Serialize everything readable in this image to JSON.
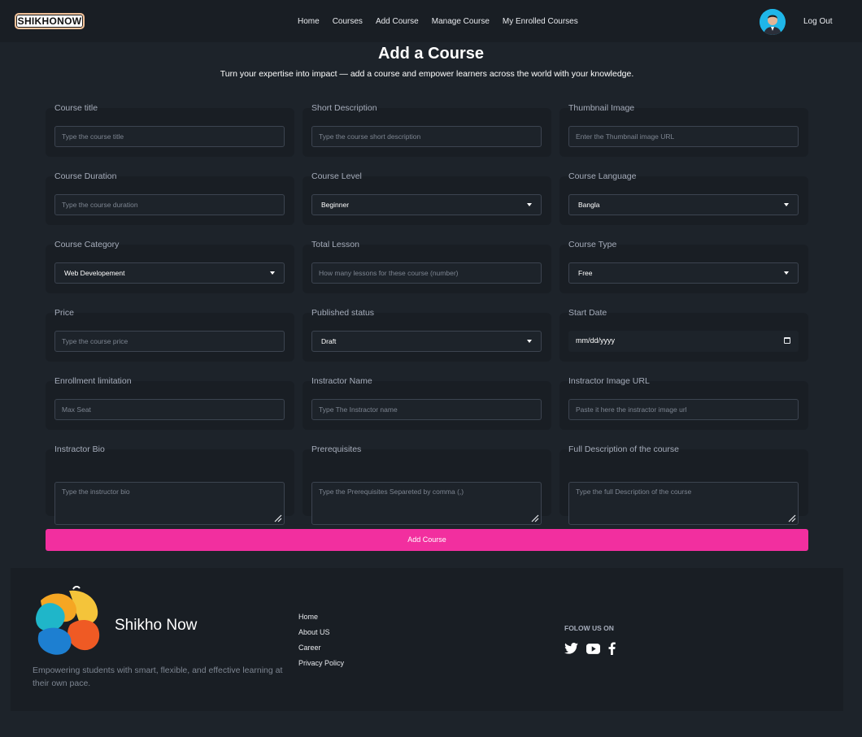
{
  "navbar": {
    "logo_text": "SHIKHONOW",
    "links": [
      "Home",
      "Courses",
      "Add Course",
      "Manage Course",
      "My Enrolled Courses"
    ],
    "logout_label": "Log Out"
  },
  "header": {
    "title": "Add a Course",
    "subtitle": "Turn your expertise into impact — add a course and empower learners across the world with your knowledge."
  },
  "form": {
    "course_title": {
      "label": "Course title",
      "placeholder": "Type the course title"
    },
    "short_description": {
      "label": "Short Description",
      "placeholder": "Type the course short description"
    },
    "thumbnail": {
      "label": "Thumbnail Image",
      "placeholder": "Enter the Thumbnail image URL"
    },
    "duration": {
      "label": "Course Duration",
      "placeholder": "Type the course duration"
    },
    "level": {
      "label": "Course Level",
      "value": "Beginner"
    },
    "language": {
      "label": "Course Language",
      "value": "Bangla"
    },
    "category": {
      "label": "Course Category",
      "value": "Web Developement"
    },
    "total_lesson": {
      "label": "Total Lesson",
      "placeholder": "How many lessons for these course (number)"
    },
    "type": {
      "label": "Course Type",
      "value": "Free"
    },
    "price": {
      "label": "Price",
      "placeholder": "Type the course price"
    },
    "published": {
      "label": "Published status",
      "value": "Draft"
    },
    "start_date": {
      "label": "Start Date",
      "value": "mm/dd/yyyy"
    },
    "enrollment": {
      "label": "Enrollment limitation",
      "placeholder": "Max Seat"
    },
    "instructor_name": {
      "label": "Instractor Name",
      "placeholder": "Type The Instractor name"
    },
    "instructor_image": {
      "label": "Instractor Image URL",
      "placeholder": "Paste it here the instractor image url"
    },
    "instructor_bio": {
      "label": "Instractor Bio",
      "placeholder": "Type the instructor bio"
    },
    "prerequisites": {
      "label": "Prerequisites",
      "placeholder": "Type the Prerequisites Separeted by comma (,)"
    },
    "full_description": {
      "label": "Full Description of the course",
      "placeholder": "Type the full Description of the course"
    },
    "submit_label": "Add Course"
  },
  "footer": {
    "brand_name": "Shikho Now",
    "brand_description": "Empowering students with smart, flexible, and effective learning at their own pace.",
    "links": [
      "Home",
      "About US",
      "Career",
      "Privacy Policy"
    ],
    "follow_label": "FOLOW US ON",
    "socials": [
      "twitter-icon",
      "youtube-icon",
      "facebook-icon"
    ]
  },
  "colors": {
    "page_bg": "#1d232a",
    "panel_bg": "#191e24",
    "accent": "#f22f9f"
  }
}
